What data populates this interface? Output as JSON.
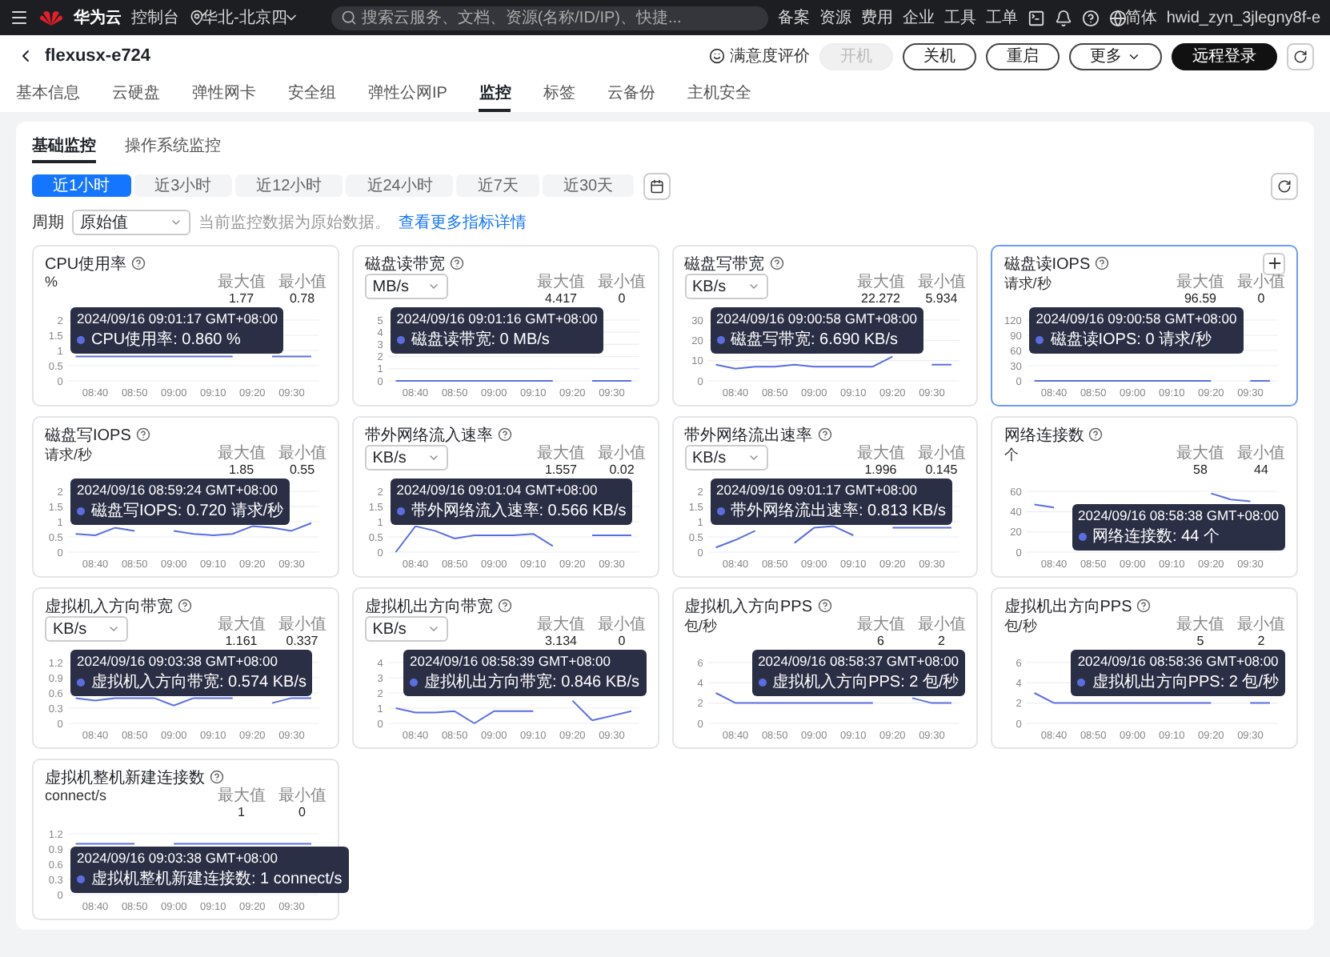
{
  "top_bar": {
    "logo": "华为云",
    "console": "控制台",
    "region": "华北-北京四",
    "search": {
      "placeholder": "搜索云服务、文档、资源(名称/ID/IP)、快捷..."
    },
    "links": [
      "备案",
      "资源",
      "费用",
      "企业",
      "工具",
      "工单"
    ],
    "language": "简体",
    "user": "hwid_zyn_3jlegny8f-e"
  },
  "header": {
    "title": "flexusx-e724",
    "feedback": "满意度评价",
    "buttons": [
      {
        "label": "开机",
        "kind": "default",
        "disabled": true
      },
      {
        "label": "关机",
        "kind": "default",
        "disabled": false
      },
      {
        "label": "重启",
        "kind": "default",
        "disabled": false
      },
      {
        "label": "更多",
        "kind": "menu",
        "disabled": false
      },
      {
        "label": "远程登录",
        "kind": "primary",
        "disabled": false
      }
    ]
  },
  "tabs": [
    {
      "label": "基本信息",
      "selected": false
    },
    {
      "label": "云硬盘",
      "selected": false
    },
    {
      "label": "弹性网卡",
      "selected": false
    },
    {
      "label": "安全组",
      "selected": false
    },
    {
      "label": "弹性公网IP",
      "selected": false
    },
    {
      "label": "监控",
      "selected": true
    },
    {
      "label": "标签",
      "selected": false
    },
    {
      "label": "云备份",
      "selected": false
    },
    {
      "label": "主机安全",
      "selected": false
    }
  ],
  "monitor": {
    "tabs": [
      {
        "label": "基础监控",
        "selected": true
      },
      {
        "label": "操作系统监控",
        "selected": false
      }
    ],
    "ranges": [
      {
        "label": "近1小时",
        "selected": true
      },
      {
        "label": "近3小时",
        "selected": false
      },
      {
        "label": "近12小时",
        "selected": false
      },
      {
        "label": "近24小时",
        "selected": false
      },
      {
        "label": "近7天",
        "selected": false
      },
      {
        "label": "近30天",
        "selected": false
      }
    ],
    "period": {
      "label": "周期",
      "value": "原始值"
    },
    "hint": "当前监控数据为原始数据。",
    "hint_link": "查看更多指标详情",
    "cards": [
      {
        "title": "CPU使用率",
        "selected": false,
        "unit": {
          "kind": "label",
          "text": "%"
        },
        "max_label": "最大值",
        "max_value": "1.77",
        "min_label": "最小值",
        "min_value": "0.78",
        "tooltip": {
          "time": "2024/09/16 09:01:17 GMT+08:00",
          "text": "CPU使用率: 0.860 %"
        },
        "chart_data": {
          "type": "line",
          "categories": [
            null,
            "08:40",
            null,
            "08:50",
            null,
            "09:00",
            null,
            "09:10",
            null,
            "09:20",
            null,
            "09:30",
            null
          ],
          "ylim": [
            0,
            2
          ],
          "yticks": [
            2,
            1.5,
            1,
            0.5,
            0
          ],
          "grid": true,
          "series": [
            {
              "color": "#5b6ee1",
              "values": [
                0.8,
                0.8,
                0.8,
                0.8,
                0.8,
                0.8,
                0.8,
                0.8,
                0.8,
                null,
                0.8,
                0.8,
                0.8
              ]
            }
          ]
        }
      },
      {
        "title": "磁盘读带宽",
        "selected": false,
        "unit": {
          "kind": "select",
          "text": "MB/s"
        },
        "max_label": "最大值",
        "max_value": "4.417",
        "min_label": "最小值",
        "min_value": "0",
        "tooltip": {
          "time": "2024/09/16 09:01:16 GMT+08:00",
          "text": "磁盘读带宽: 0 MB/s"
        },
        "chart_data": {
          "type": "line",
          "categories": [
            null,
            "08:40",
            null,
            "08:50",
            null,
            "09:00",
            null,
            "09:10",
            null,
            "09:20",
            null,
            "09:30",
            null
          ],
          "ylim": [
            0,
            5
          ],
          "yticks": [
            5,
            4,
            3,
            2,
            1,
            0
          ],
          "grid": true,
          "series": [
            {
              "color": "#5b6ee1",
              "values": [
                0,
                0,
                0,
                0,
                0,
                0,
                0,
                0,
                0,
                null,
                0,
                0,
                0
              ]
            }
          ]
        }
      },
      {
        "title": "磁盘写带宽",
        "selected": false,
        "unit": {
          "kind": "select",
          "text": "KB/s"
        },
        "max_label": "最大值",
        "max_value": "22.272",
        "min_label": "最小值",
        "min_value": "5.934",
        "tooltip": {
          "time": "2024/09/16 09:00:58 GMT+08:00",
          "text": "磁盘写带宽: 6.690 KB/s"
        },
        "chart_data": {
          "type": "line",
          "categories": [
            null,
            "08:40",
            null,
            "08:50",
            null,
            "09:00",
            null,
            "09:10",
            null,
            "09:20",
            null,
            "09:30",
            null
          ],
          "ylim": [
            0,
            30
          ],
          "yticks": [
            30,
            20,
            10,
            0
          ],
          "grid": true,
          "series": [
            {
              "color": "#5b6ee1",
              "values": [
                8,
                6,
                7,
                7,
                8,
                7,
                7,
                7,
                7,
                12,
                null,
                8,
                8
              ]
            }
          ]
        }
      },
      {
        "title": "磁盘读IOPS",
        "selected": true,
        "unit": {
          "kind": "label",
          "text": "请求/秒"
        },
        "max_label": "最大值",
        "max_value": "96.59",
        "min_label": "最小值",
        "min_value": "0",
        "tooltip": {
          "time": "2024/09/16 09:00:58 GMT+08:00",
          "text": "磁盘读IOPS: 0 请求/秒"
        },
        "chart_data": {
          "type": "line",
          "categories": [
            null,
            "08:40",
            null,
            "08:50",
            null,
            "09:00",
            null,
            "09:10",
            null,
            "09:20",
            null,
            "09:30",
            null
          ],
          "ylim": [
            0,
            120
          ],
          "yticks": [
            120,
            90,
            60,
            30,
            0
          ],
          "grid": true,
          "series": [
            {
              "color": "#5b6ee1",
              "values": [
                0,
                0,
                0,
                0,
                0,
                0,
                0,
                0,
                0,
                0,
                null,
                0,
                0
              ]
            }
          ]
        }
      },
      {
        "title": "磁盘写IOPS",
        "selected": false,
        "unit": {
          "kind": "label",
          "text": "请求/秒"
        },
        "max_label": "最大值",
        "max_value": "1.85",
        "min_label": "最小值",
        "min_value": "0.55",
        "tooltip": {
          "time": "2024/09/16 08:59:24 GMT+08:00",
          "text": "磁盘写IOPS: 0.720 请求/秒"
        },
        "chart_data": {
          "type": "line",
          "categories": [
            null,
            "08:40",
            null,
            "08:50",
            null,
            "09:00",
            null,
            "09:10",
            null,
            "09:20",
            null,
            "09:30",
            null
          ],
          "ylim": [
            0,
            2
          ],
          "yticks": [
            2,
            1.5,
            1,
            0.5,
            0
          ],
          "grid": true,
          "series": [
            {
              "color": "#5b6ee1",
              "values": [
                0.6,
                0.55,
                0.8,
                0.7,
                null,
                0.7,
                0.6,
                0.55,
                0.6,
                0.85,
                0.8,
                0.7,
                0.95
              ]
            }
          ]
        }
      },
      {
        "title": "带外网络流入速率",
        "selected": false,
        "unit": {
          "kind": "select",
          "text": "KB/s"
        },
        "max_label": "最大值",
        "max_value": "1.557",
        "min_label": "最小值",
        "min_value": "0.02",
        "tooltip": {
          "time": "2024/09/16 09:01:04 GMT+08:00",
          "text": "带外网络流入速率: 0.566 KB/s"
        },
        "chart_data": {
          "type": "line",
          "categories": [
            null,
            "08:40",
            null,
            "08:50",
            null,
            "09:00",
            null,
            "09:10",
            null,
            "09:20",
            null,
            "09:30",
            null
          ],
          "ylim": [
            0,
            2
          ],
          "yticks": [
            2,
            1.5,
            1,
            0.5,
            0
          ],
          "grid": true,
          "series": [
            {
              "color": "#5b6ee1",
              "values": [
                0,
                0.85,
                0.7,
                0.45,
                0.55,
                0.55,
                0.55,
                0.6,
                0.2,
                null,
                0.55,
                0.55,
                0.55
              ]
            }
          ]
        }
      },
      {
        "title": "带外网络流出速率",
        "selected": false,
        "unit": {
          "kind": "select",
          "text": "KB/s"
        },
        "max_label": "最大值",
        "max_value": "1.996",
        "min_label": "最小值",
        "min_value": "0.145",
        "tooltip": {
          "time": "2024/09/16 09:01:17 GMT+08:00",
          "text": "带外网络流出速率: 0.813 KB/s"
        },
        "chart_data": {
          "type": "line",
          "categories": [
            null,
            "08:40",
            null,
            "08:50",
            null,
            "09:00",
            null,
            "09:10",
            null,
            "09:20",
            null,
            "09:30",
            null
          ],
          "ylim": [
            0,
            2
          ],
          "yticks": [
            2,
            1.5,
            1,
            0.5,
            0
          ],
          "grid": true,
          "series": [
            {
              "color": "#5b6ee1",
              "values": [
                0.15,
                0.4,
                0.7,
                null,
                0.3,
                0.8,
                0.85,
                0.55,
                null,
                0.8,
                0.8,
                0.8,
                0.8
              ]
            }
          ]
        }
      },
      {
        "title": "网络连接数",
        "selected": false,
        "unit": {
          "kind": "label",
          "text": "个"
        },
        "max_label": "最大值",
        "max_value": "58",
        "min_label": "最小值",
        "min_value": "44",
        "tooltip": {
          "time": "2024/09/16 08:58:38 GMT+08:00",
          "text": "网络连接数: 44 个"
        },
        "chart_data": {
          "type": "line",
          "categories": [
            null,
            "08:40",
            null,
            "08:50",
            null,
            "09:00",
            null,
            "09:10",
            null,
            "09:20",
            null,
            "09:30",
            null
          ],
          "ylim": [
            0,
            60
          ],
          "yticks": [
            60,
            40,
            20,
            0
          ],
          "grid": true,
          "series": [
            {
              "color": "#5b6ee1",
              "values": [
                47,
                44,
                null,
                null,
                null,
                null,
                null,
                null,
                null,
                58,
                52,
                50,
                null
              ]
            }
          ]
        }
      },
      {
        "title": "虚拟机入方向带宽",
        "selected": false,
        "unit": {
          "kind": "select",
          "text": "KB/s"
        },
        "max_label": "最大值",
        "max_value": "1.161",
        "min_label": "最小值",
        "min_value": "0.337",
        "tooltip": {
          "time": "2024/09/16 09:03:38 GMT+08:00",
          "text": "虚拟机入方向带宽: 0.574 KB/s"
        },
        "chart_data": {
          "type": "line",
          "categories": [
            null,
            "08:40",
            null,
            "08:50",
            null,
            "09:00",
            null,
            "09:10",
            null,
            "09:20",
            null,
            "09:30",
            null
          ],
          "ylim": [
            0,
            1.2
          ],
          "yticks": [
            1.2,
            0.9,
            0.6,
            0.3,
            0
          ],
          "grid": true,
          "series": [
            {
              "color": "#5b6ee1",
              "values": [
                0.5,
                0.45,
                0.5,
                0.5,
                0.5,
                0.35,
                0.5,
                0.5,
                0.5,
                null,
                0.4,
                0.5,
                0.5
              ]
            }
          ]
        }
      },
      {
        "title": "虚拟机出方向带宽",
        "selected": false,
        "unit": {
          "kind": "select",
          "text": "KB/s"
        },
        "max_label": "最大值",
        "max_value": "3.134",
        "min_label": "最小值",
        "min_value": "0",
        "tooltip": {
          "time": "2024/09/16 08:58:39 GMT+08:00",
          "text": "虚拟机出方向带宽: 0.846 KB/s"
        },
        "chart_data": {
          "type": "line",
          "categories": [
            null,
            "08:40",
            null,
            "08:50",
            null,
            "09:00",
            null,
            "09:10",
            null,
            "09:20",
            null,
            "09:30",
            null
          ],
          "ylim": [
            0,
            4
          ],
          "yticks": [
            4,
            3,
            2,
            1,
            0
          ],
          "grid": true,
          "series": [
            {
              "color": "#5b6ee1",
              "values": [
                1,
                0.7,
                0.7,
                0.8,
                0,
                0.8,
                0.8,
                0.8,
                null,
                1.5,
                0.2,
                0.5,
                0.8
              ]
            }
          ]
        }
      },
      {
        "title": "虚拟机入方向PPS",
        "selected": false,
        "unit": {
          "kind": "label",
          "text": "包/秒"
        },
        "max_label": "最大值",
        "max_value": "6",
        "min_label": "最小值",
        "min_value": "2",
        "tooltip": {
          "time": "2024/09/16 08:58:37 GMT+08:00",
          "text": "虚拟机入方向PPS: 2 包/秒"
        },
        "chart_data": {
          "type": "line",
          "categories": [
            null,
            "08:40",
            null,
            "08:50",
            null,
            "09:00",
            null,
            "09:10",
            null,
            "09:20",
            null,
            "09:30",
            null
          ],
          "ylim": [
            0,
            6
          ],
          "yticks": [
            6,
            4,
            2,
            0
          ],
          "grid": true,
          "series": [
            {
              "color": "#5b6ee1",
              "values": [
                3,
                2,
                2,
                2,
                2,
                2,
                2,
                2,
                2,
                null,
                2.5,
                2,
                2
              ]
            }
          ]
        }
      },
      {
        "title": "虚拟机出方向PPS",
        "selected": false,
        "unit": {
          "kind": "label",
          "text": "包/秒"
        },
        "max_label": "最大值",
        "max_value": "5",
        "min_label": "最小值",
        "min_value": "2",
        "tooltip": {
          "time": "2024/09/16 08:58:36 GMT+08:00",
          "text": "虚拟机出方向PPS: 2 包/秒"
        },
        "chart_data": {
          "type": "line",
          "categories": [
            null,
            "08:40",
            null,
            "08:50",
            null,
            "09:00",
            null,
            "09:10",
            null,
            "09:20",
            null,
            "09:30",
            null
          ],
          "ylim": [
            0,
            6
          ],
          "yticks": [
            6,
            4,
            2,
            0
          ],
          "grid": true,
          "series": [
            {
              "color": "#5b6ee1",
              "values": [
                3,
                2,
                2,
                2,
                2,
                2,
                2,
                2,
                2,
                2,
                null,
                2,
                2
              ]
            }
          ]
        }
      },
      {
        "title": "虚拟机整机新建连接数",
        "selected": false,
        "unit": {
          "kind": "label",
          "text": "connect/s"
        },
        "max_label": "最大值",
        "max_value": "1",
        "min_label": "最小值",
        "min_value": "0",
        "tooltip": {
          "time": "2024/09/16 09:03:38 GMT+08:00",
          "text": "虚拟机整机新建连接数: 1 connect/s"
        },
        "chart_data": {
          "type": "line",
          "categories": [
            null,
            "08:40",
            null,
            "08:50",
            null,
            "09:00",
            null,
            "09:10",
            null,
            "09:20",
            null,
            "09:30",
            null
          ],
          "ylim": [
            0,
            1.2
          ],
          "yticks": [
            1.2,
            0.9,
            0.6,
            0.3,
            0
          ],
          "grid": true,
          "series": [
            {
              "color": "#5b6ee1",
              "values": [
                1,
                1,
                1,
                1,
                null,
                1,
                1,
                1,
                1,
                1,
                1,
                1,
                1
              ]
            }
          ]
        }
      }
    ]
  }
}
